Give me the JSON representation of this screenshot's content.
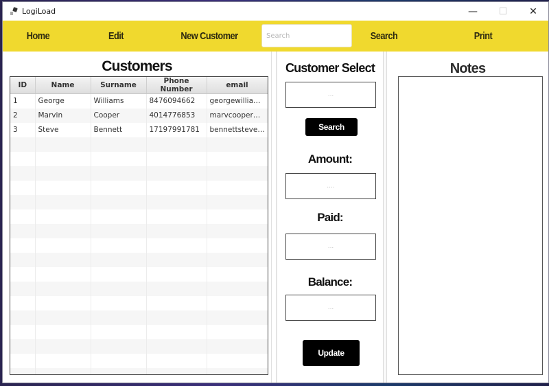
{
  "window": {
    "title": "LogiLoad",
    "controls": {
      "minimize": "—",
      "maximize": "☐",
      "close": "✕"
    }
  },
  "nav": {
    "home": "Home",
    "edit": "Edit",
    "new_customer": "New Customer",
    "search_placeholder": "Search",
    "search": "Search",
    "print": "Print"
  },
  "customers": {
    "title": "Customers",
    "columns": [
      "ID",
      "Name",
      "Surname",
      "Phone Number",
      "email"
    ],
    "rows": [
      [
        "1",
        "George",
        "Williams",
        "8476094662",
        "georgewilliams..."
      ],
      [
        "2",
        "Marvin",
        "Cooper",
        "4014776853",
        "marvcooper@g..."
      ],
      [
        "3",
        "Steve",
        "Bennett",
        "17197991781",
        "bennettsteve@..."
      ]
    ],
    "empty_rows": 17
  },
  "select": {
    "title": "Customer Select",
    "customer_placeholder": "...",
    "search_button": "Search",
    "amount_label": "Amount:",
    "amount_placeholder": "....",
    "paid_label": "Paid:",
    "paid_placeholder": "...",
    "balance_label": "Balance:",
    "balance_placeholder": "...",
    "update_button": "Update"
  },
  "notes": {
    "title": "Notes",
    "value": ""
  },
  "colors": {
    "navbar": "#f0d92e",
    "nav_text": "#2d2a10",
    "button": "#000000"
  }
}
